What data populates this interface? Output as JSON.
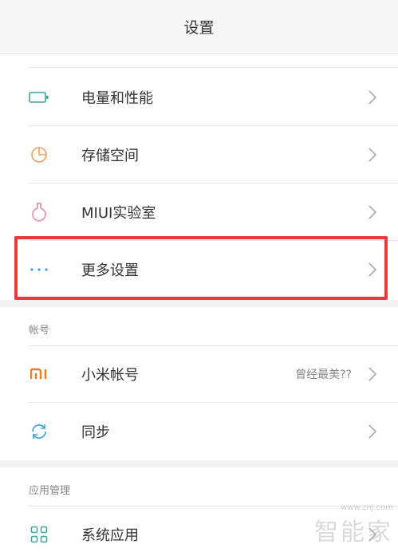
{
  "header": {
    "title": "设置"
  },
  "section1": {
    "items": [
      {
        "label": "电量和性能",
        "icon": "battery-icon"
      },
      {
        "label": "存储空间",
        "icon": "storage-pie-icon"
      },
      {
        "label": "MIUI实验室",
        "icon": "flask-icon"
      },
      {
        "label": "更多设置",
        "icon": "more-dots-icon",
        "highlighted": true
      }
    ]
  },
  "account_section": {
    "header": "帐号",
    "items": [
      {
        "label": "小米帐号",
        "value": "曾经最美??",
        "icon": "mi-logo-icon"
      },
      {
        "label": "同步",
        "icon": "sync-icon"
      }
    ]
  },
  "apps_section": {
    "header": "应用管理",
    "items": [
      {
        "label": "系统应用",
        "icon": "grid-apps-icon"
      }
    ]
  },
  "watermark": {
    "url": "www.znj.com",
    "text": "智能家"
  },
  "colors": {
    "accent_teal": "#3aa6a0",
    "accent_orange": "#f0a061",
    "accent_pink": "#e58ba8",
    "accent_blue": "#3c9fe3",
    "mi_orange": "#f5771e",
    "highlight_red": "#e83a3a"
  }
}
